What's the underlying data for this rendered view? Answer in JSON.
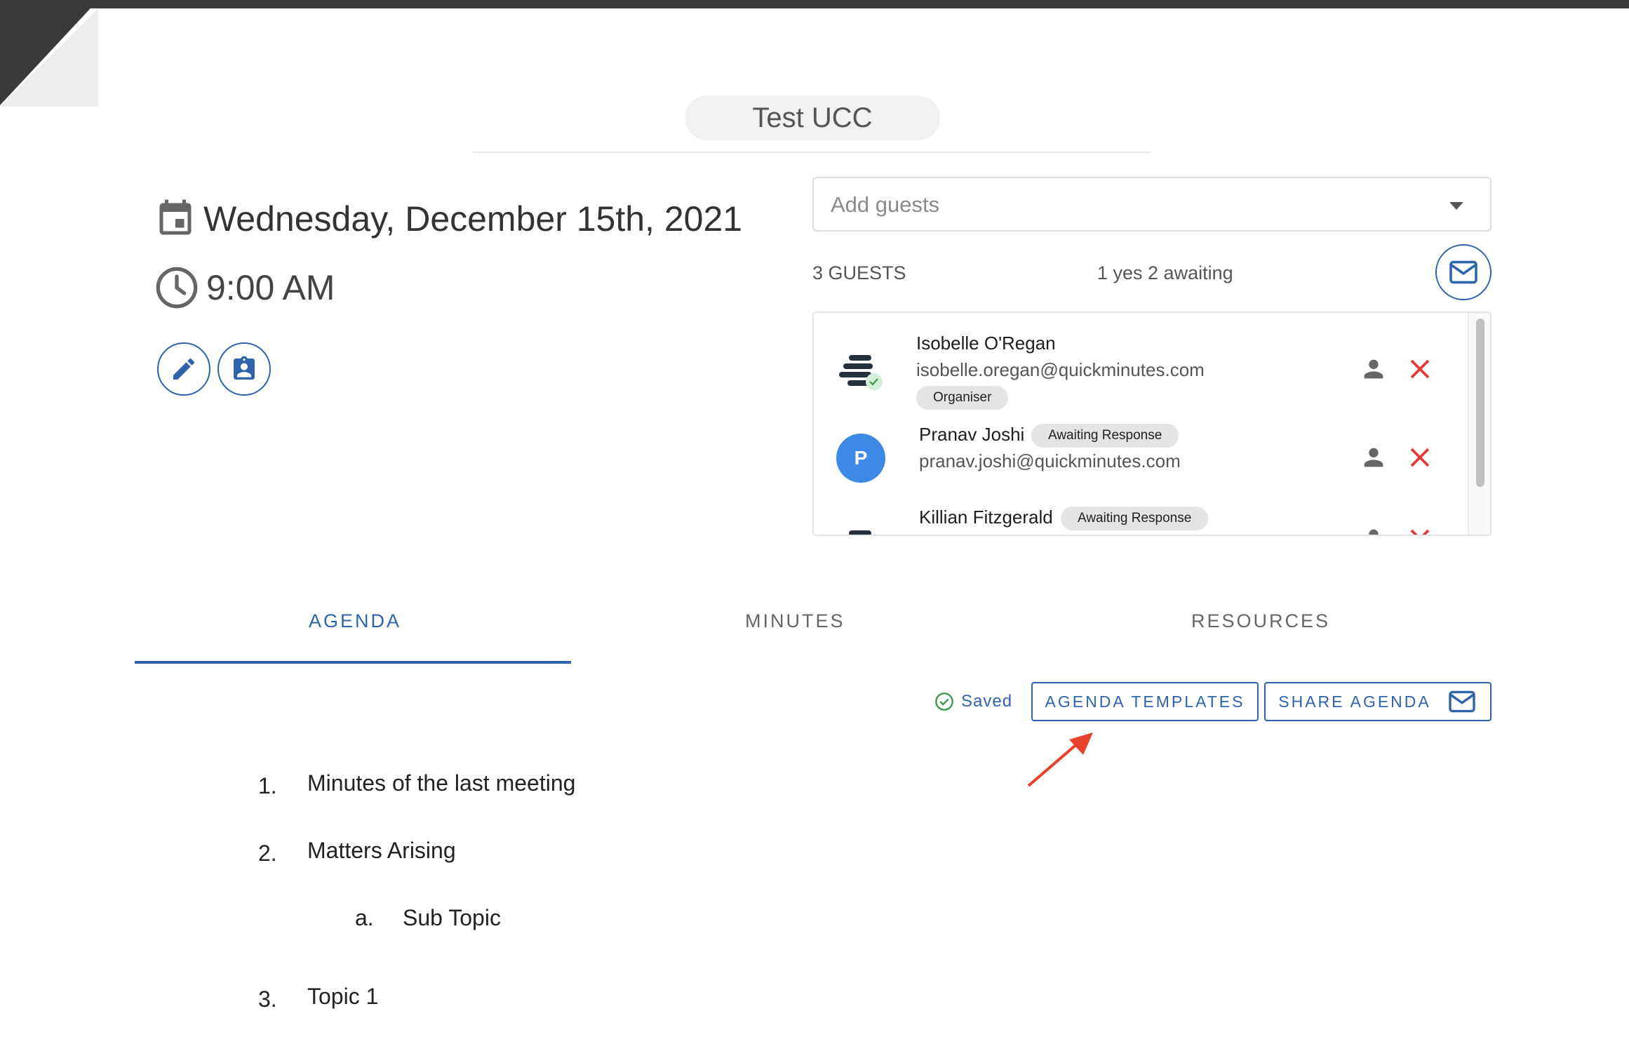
{
  "meeting": {
    "title": "Test UCC",
    "date": "Wednesday, December 15th, 2021",
    "time": "9:00 AM"
  },
  "guests": {
    "placeholder": "Add guests",
    "count_label": "3 GUESTS",
    "summary": "1 yes 2 awaiting",
    "list": [
      {
        "name": "Isobelle O'Regan",
        "email": "isobelle.oregan@quickminutes.com",
        "badge": "Organiser"
      },
      {
        "name": "Pranav Joshi",
        "email": "pranav.joshi@quickminutes.com",
        "badge": "Awaiting Response",
        "initial": "P"
      },
      {
        "name": "Killian Fitzgerald",
        "badge": "Awaiting Response"
      }
    ]
  },
  "tabs": [
    {
      "label": "AGENDA"
    },
    {
      "label": "MINUTES"
    },
    {
      "label": "RESOURCES"
    }
  ],
  "toolbar": {
    "saved_label": "Saved",
    "templates_label": "AGENDA TEMPLATES",
    "share_label": "SHARE AGENDA"
  },
  "agenda": [
    {
      "num": "1.",
      "text": "Minutes of the last meeting"
    },
    {
      "num": "2.",
      "text": "Matters Arising"
    },
    {
      "num": "a.",
      "text": "Sub Topic"
    },
    {
      "num": "3.",
      "text": "Topic 1"
    }
  ],
  "colors": {
    "accent": "#2f64ad",
    "remove": "#e53935",
    "avatar_p": "#3d8ae6",
    "annotation_arrow": "#e8412c"
  }
}
